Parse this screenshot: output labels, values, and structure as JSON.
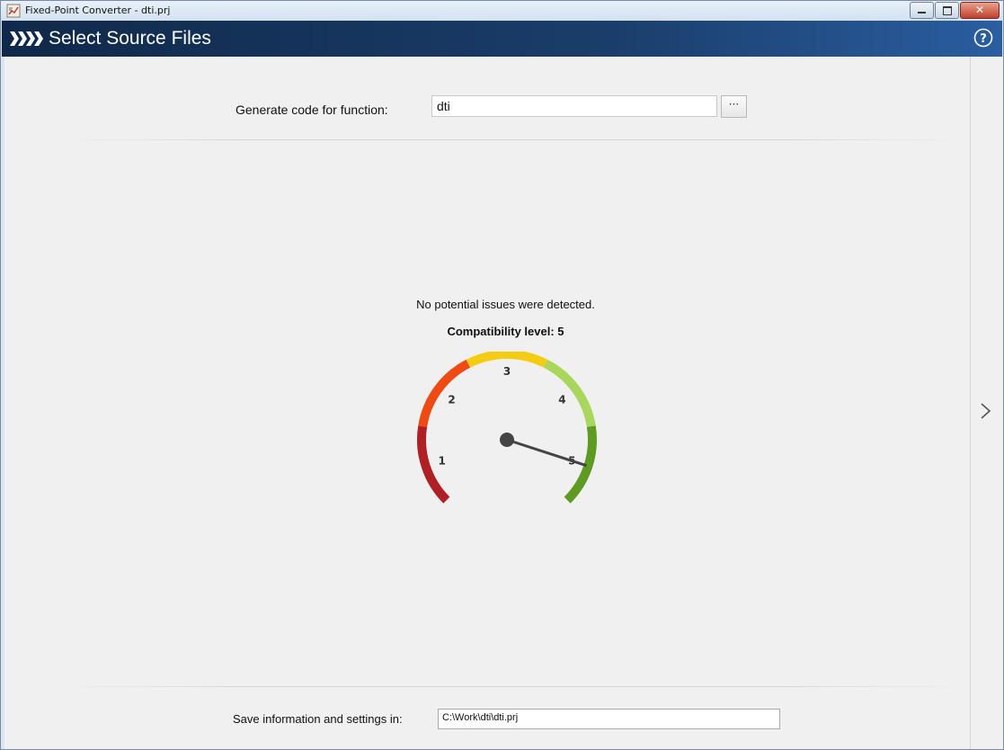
{
  "window": {
    "title": "Fixed-Point Converter - dti.prj",
    "buttons": [
      "minimize-icon",
      "maximize-icon",
      "close-icon"
    ]
  },
  "header": {
    "title": "Select Source Files",
    "help_icon": "help-icon"
  },
  "function_field": {
    "label": "Generate code for function:",
    "value": "dti",
    "browse_label": "···"
  },
  "result": {
    "message": "No potential issues were detected.",
    "compatibility_text": "Compatibility level: 5",
    "level": 5,
    "scale_labels": [
      "1",
      "2",
      "3",
      "4",
      "5"
    ],
    "segment_colors": [
      "#b01f24",
      "#f04a14",
      "#f4cd12",
      "#a9d65c",
      "#5f9a22"
    ],
    "needle_color": "#444444"
  },
  "settings_field": {
    "label": "Save information and settings in:",
    "value": "C:\\Work\\dti\\dti.prj"
  },
  "navigation": {
    "next_icon": "chevron-right-icon"
  }
}
